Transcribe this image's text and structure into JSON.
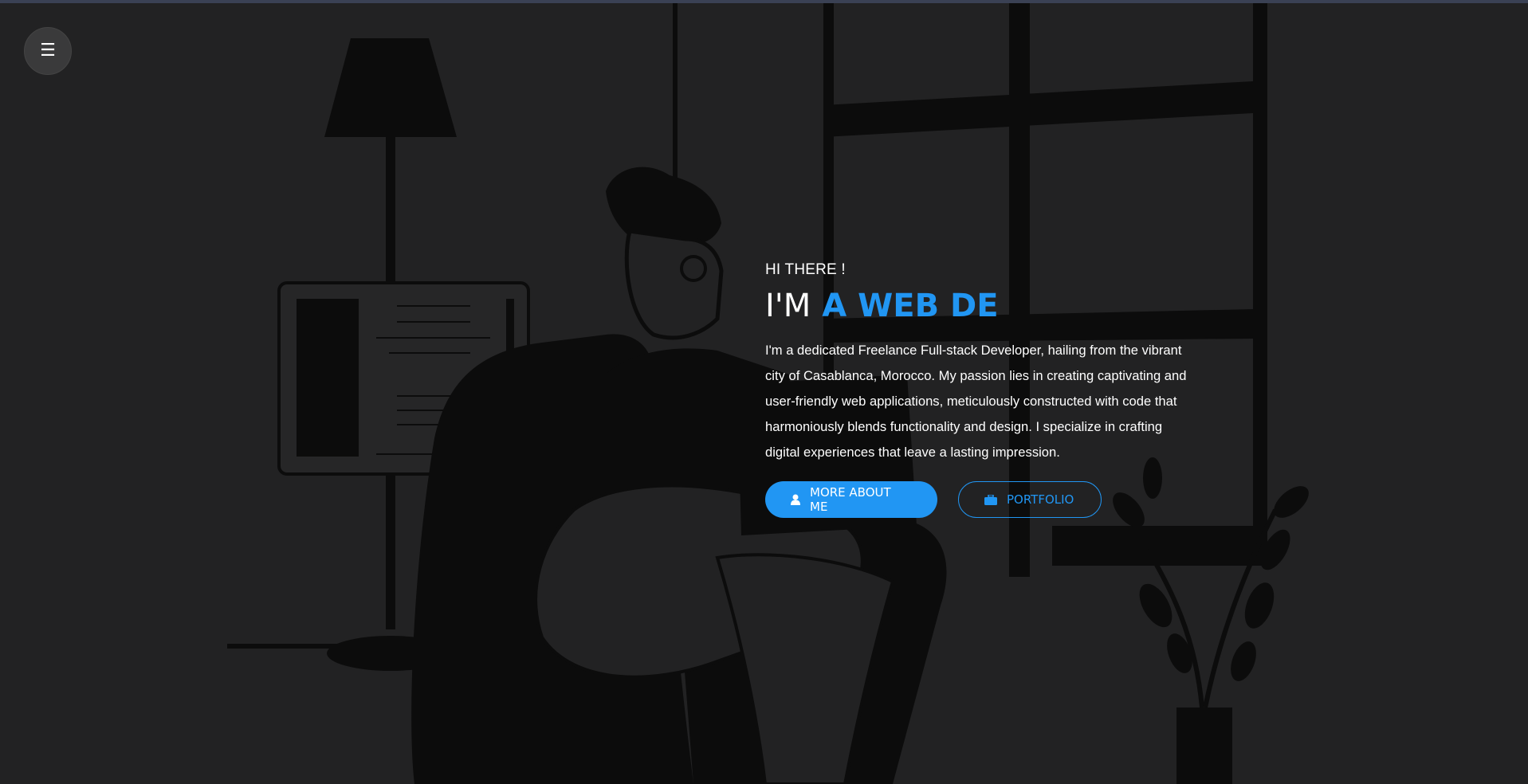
{
  "nav": {
    "menu_icon": "hamburger-icon",
    "menu_glyph": "☰"
  },
  "hero": {
    "greeting": "HI THERE !",
    "headline_static": "I'M",
    "headline_typed": "A WEB DE",
    "bio": "I'm a dedicated Freelance Full-stack Developer, hailing from the vibrant city of Casablanca, Morocco. My passion lies in creating captivating and user-friendly web applications, meticulously constructed with code that harmoniously blends functionality and design. I specialize in crafting digital experiences that leave a lasting impression.",
    "primary_button": {
      "label": "MORE ABOUT ME",
      "icon": "user-icon"
    },
    "secondary_button": {
      "label": "PORTFOLIO",
      "icon": "briefcase-icon"
    }
  },
  "background": {
    "illustration": "person-reading-illustration"
  },
  "colors": {
    "accent": "#2196f3",
    "background": "#222223",
    "text": "#ffffff"
  }
}
